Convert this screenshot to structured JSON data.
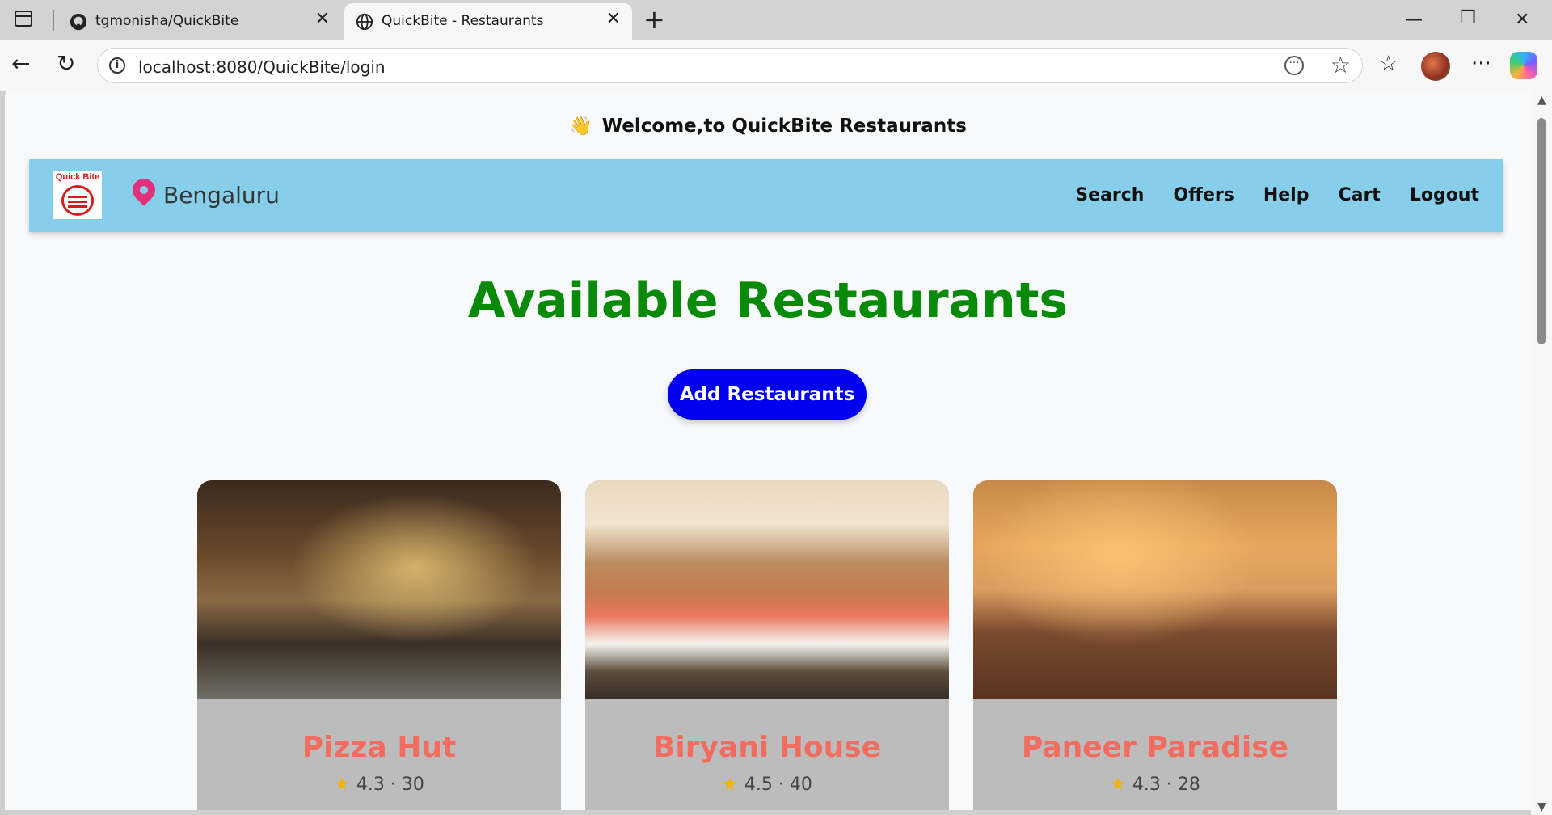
{
  "browser": {
    "tabs": [
      {
        "title": "tgmonisha/QuickBite",
        "icon": "github-icon",
        "active": false
      },
      {
        "title": "QuickBite - Restaurants",
        "icon": "globe-icon",
        "active": true
      }
    ],
    "url": "localhost:8080/QuickBite/login"
  },
  "page": {
    "welcome": "Welcome,to QuickBite Restaurants",
    "welcome_emoji": "👋",
    "navbar": {
      "logo_text": "Quick Bite",
      "city": "Bengaluru",
      "links": [
        "Search",
        "Offers",
        "Help",
        "Cart",
        "Logout"
      ]
    },
    "title": "Available Restaurants",
    "add_button": "Add Restaurants",
    "restaurants": [
      {
        "name": "Pizza Hut",
        "rating": "4.3",
        "eta": "30"
      },
      {
        "name": "Biryani House",
        "rating": "4.5",
        "eta": "40"
      },
      {
        "name": "Paneer Paradise",
        "rating": "4.3",
        "eta": "28"
      }
    ],
    "colors": {
      "navbar": "#87ceeb",
      "title": "#078a07",
      "button": "#0000ee",
      "card_name": "#f36c60"
    }
  }
}
